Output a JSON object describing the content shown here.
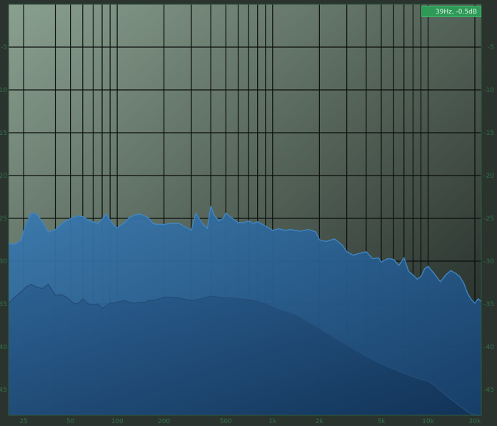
{
  "readout": "39Hz, -0.5dB",
  "colors": {
    "background_light": "#8aa08f",
    "background_dark": "#1c2320",
    "grid": "#0a0d0b",
    "tick_text": "#35704a",
    "frame": "#2f5a3c",
    "upper_fill": "#2f6fa6",
    "upper_stroke": "#3f86c4",
    "lower_fill": "#1f4f80",
    "lower_stroke": "#244e78",
    "readout_bg": "#2f9a58"
  },
  "chart_data": {
    "type": "area",
    "x_scale": "log",
    "xlim": [
      20,
      22000
    ],
    "ylim": [
      -48,
      0
    ],
    "x_tick_labels": [
      {
        "value": 25,
        "label": "25"
      },
      {
        "value": 50,
        "label": "50"
      },
      {
        "value": 100,
        "label": "100"
      },
      {
        "value": 200,
        "label": "200"
      },
      {
        "value": 500,
        "label": "500"
      },
      {
        "value": 1000,
        "label": "1k"
      },
      {
        "value": 2000,
        "label": "2k"
      },
      {
        "value": 5000,
        "label": "5k"
      },
      {
        "value": 10000,
        "label": "10k"
      },
      {
        "value": 20000,
        "label": "20k"
      }
    ],
    "x_grid": [
      25,
      40,
      50,
      60,
      70,
      80,
      90,
      100,
      200,
      300,
      400,
      500,
      600,
      700,
      800,
      900,
      1000,
      2000,
      3000,
      4000,
      5000,
      6000,
      7000,
      8000,
      9000,
      10000,
      20000
    ],
    "y_ticks": [
      {
        "value": -5,
        "label": "-5"
      },
      {
        "value": -10,
        "label": "-10"
      },
      {
        "value": -15,
        "label": "-15"
      },
      {
        "value": -20,
        "label": "-20"
      },
      {
        "value": -25,
        "label": "-25"
      },
      {
        "value": -30,
        "label": "-30"
      },
      {
        "value": -35,
        "label": "-35"
      },
      {
        "value": -40,
        "label": "-40"
      },
      {
        "value": -45,
        "label": "-45"
      }
    ],
    "series": [
      {
        "x": [
          20,
          22,
          24,
          26,
          28,
          30,
          33,
          36,
          40,
          44,
          48,
          52,
          56,
          60,
          65,
          70,
          75,
          80,
          85,
          90,
          95,
          100,
          110,
          120,
          130,
          140,
          150,
          160,
          170,
          180,
          200,
          220,
          250,
          280,
          300,
          320,
          350,
          380,
          400,
          420,
          450,
          480,
          500,
          550,
          600,
          650,
          700,
          750,
          800,
          900,
          1000,
          1100,
          1200,
          1300,
          1400,
          1500,
          1700,
          1900,
          2000,
          2200,
          2500,
          2800,
          3000,
          3300,
          3600,
          4000,
          4400,
          4800,
          5000,
          5500,
          6000,
          6500,
          7000,
          7500,
          8000,
          8500,
          9000,
          9500,
          10000,
          11000,
          12000,
          13000,
          14000,
          15000,
          16000,
          17000,
          18000,
          19000,
          20000,
          21000,
          22000
        ],
        "y": [
          -28.0,
          -28.0,
          -27.6,
          -25.6,
          -24.4,
          -24.4,
          -25.4,
          -26.6,
          -26.3,
          -25.6,
          -25.2,
          -24.9,
          -24.7,
          -24.8,
          -25.2,
          -25.4,
          -25.6,
          -25.1,
          -24.5,
          -25.2,
          -25.8,
          -26.1,
          -25.6,
          -24.9,
          -24.6,
          -24.5,
          -24.7,
          -25.0,
          -25.6,
          -25.7,
          -25.7,
          -25.6,
          -25.6,
          -26.1,
          -26.4,
          -24.4,
          -25.5,
          -26.2,
          -23.6,
          -24.6,
          -25.3,
          -25.0,
          -24.4,
          -25.0,
          -25.5,
          -25.5,
          -25.3,
          -25.6,
          -25.4,
          -25.9,
          -26.4,
          -26.2,
          -26.4,
          -26.3,
          -26.4,
          -26.5,
          -26.3,
          -26.6,
          -27.5,
          -27.7,
          -27.4,
          -28.1,
          -28.9,
          -29.3,
          -29.1,
          -28.9,
          -29.7,
          -29.6,
          -30.1,
          -29.7,
          -29.8,
          -30.5,
          -29.6,
          -31.2,
          -31.6,
          -32.1,
          -31.8,
          -30.9,
          -30.6,
          -31.5,
          -32.4,
          -31.6,
          -31.1,
          -31.4,
          -31.8,
          -32.6,
          -33.8,
          -34.5,
          -34.9,
          -34.4,
          -34.7
        ]
      },
      {
        "x": [
          20,
          22,
          24,
          26,
          28,
          30,
          33,
          36,
          40,
          44,
          48,
          52,
          56,
          60,
          65,
          70,
          75,
          80,
          85,
          90,
          95,
          100,
          110,
          120,
          130,
          140,
          150,
          160,
          180,
          200,
          220,
          250,
          280,
          300,
          330,
          360,
          400,
          450,
          500,
          550,
          600,
          700,
          800,
          900,
          1000,
          1200,
          1400,
          1600,
          1800,
          2000,
          2500,
          3000,
          3500,
          4000,
          5000,
          6000,
          7000,
          8000,
          9000,
          10000,
          11000,
          12000,
          14000,
          16000,
          18000,
          20000,
          22000
        ],
        "y": [
          -34.9,
          -34.2,
          -33.6,
          -33.0,
          -32.7,
          -33.0,
          -33.2,
          -32.7,
          -34.0,
          -33.9,
          -34.3,
          -34.9,
          -35.0,
          -34.4,
          -35.0,
          -35.1,
          -35.0,
          -35.5,
          -35.2,
          -34.9,
          -34.9,
          -34.8,
          -34.6,
          -34.8,
          -34.9,
          -34.8,
          -34.8,
          -34.6,
          -34.5,
          -34.2,
          -34.2,
          -34.3,
          -34.5,
          -34.6,
          -34.5,
          -34.3,
          -34.1,
          -34.2,
          -34.3,
          -34.3,
          -34.4,
          -34.5,
          -34.7,
          -35.0,
          -35.4,
          -35.9,
          -36.3,
          -36.9,
          -37.4,
          -37.9,
          -39.0,
          -39.8,
          -40.5,
          -41.1,
          -42.0,
          -42.6,
          -43.1,
          -43.5,
          -43.8,
          -44.0,
          -44.5,
          -45.1,
          -46.1,
          -46.9,
          -47.6,
          -48.0,
          -48.0
        ]
      }
    ]
  }
}
